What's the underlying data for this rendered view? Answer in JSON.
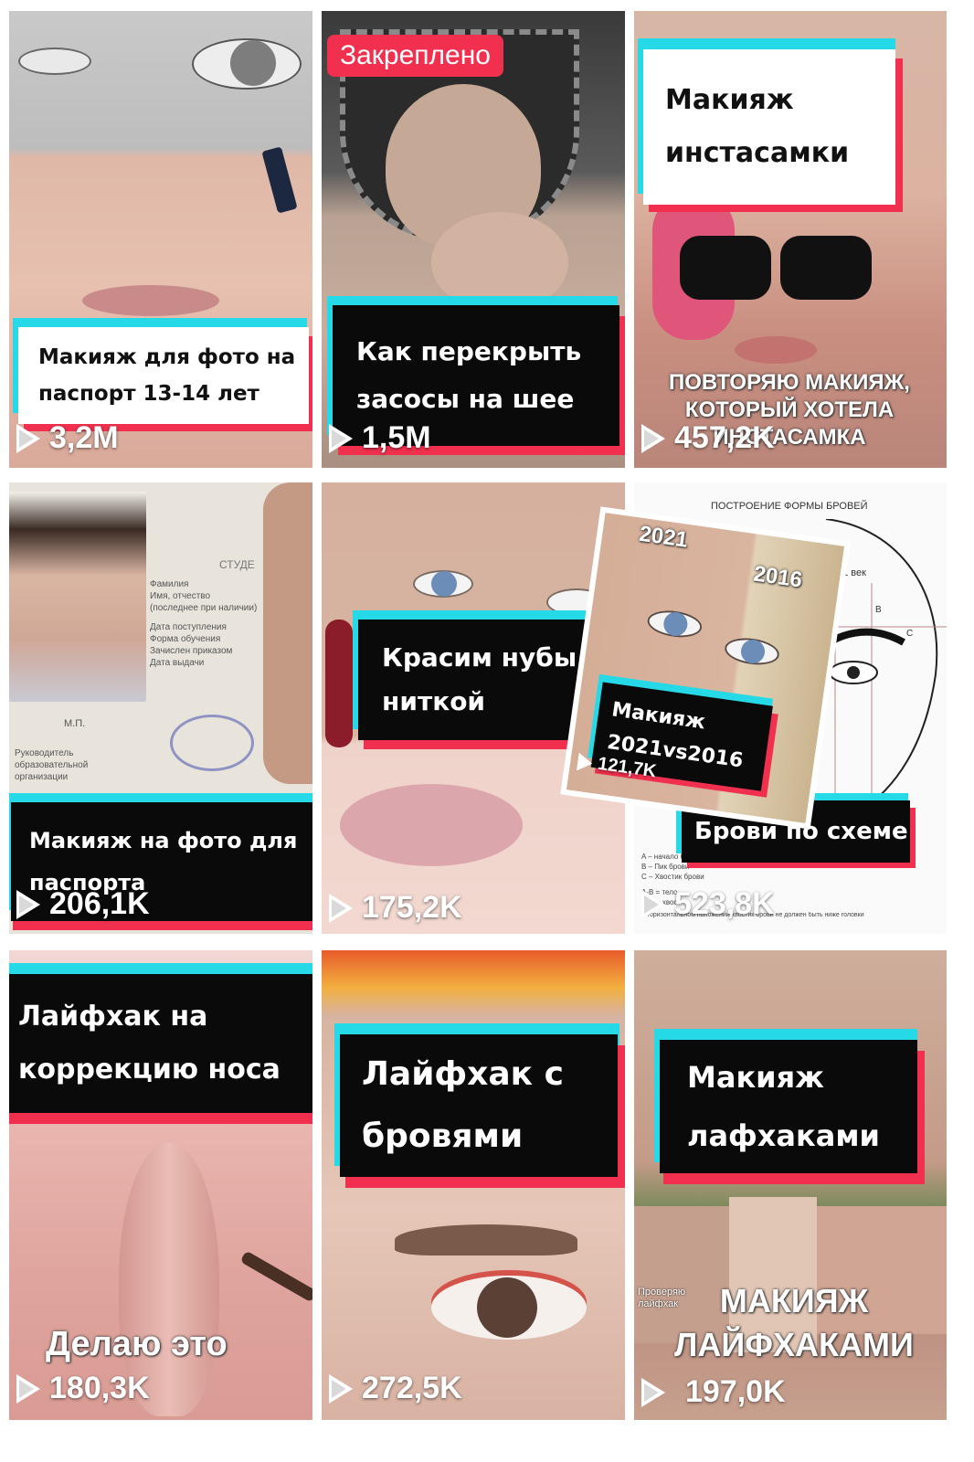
{
  "pinned_label": "Закреплено",
  "colors": {
    "cyan": "#25d9e6",
    "red": "#f0304e",
    "black": "#0a0a0a"
  },
  "icons": {
    "views": "play-icon"
  },
  "tiles": [
    {
      "lines": [
        "Макияж для фото на",
        "паспорт 13-14 лет"
      ],
      "views": "3,2M"
    },
    {
      "lines": [
        "Как перекрыть",
        "засосы на шее"
      ],
      "views": "1,5M"
    },
    {
      "lines": [
        "Макияж",
        "инстасамки"
      ],
      "views": "457,2K",
      "overlay": [
        "ПОВТОРЯЮ МАКИЯЖ,",
        "КОТОРЫЙ ХОТЕЛА",
        "ИНСТАСАМКА"
      ]
    },
    {
      "lines": [
        "Макияж на фото для",
        "паспорта"
      ],
      "views": "206,1K",
      "doc": {
        "title": "СТУДЕ",
        "rows": [
          "Фамилия",
          "Имя, отчество",
          "(последнее при наличии)",
          "Дата поступления",
          "Форма обучения",
          "Зачислен приказом",
          "Дата выдачи"
        ],
        "stamp": "М.П.",
        "footer": [
          "Руководитель",
          "образовательной",
          "организации"
        ]
      }
    },
    {
      "lines": [
        "Красим нубы",
        "ниткой"
      ],
      "views": "175,2K"
    },
    {
      "lines": [
        "Брови по схеме"
      ],
      "views": "523,8K",
      "header": "ПОСТРОЕНИЕ ФОРМЫ БРОВЕЙ",
      "diagram_labels": [
        "21 век",
        "A",
        "B",
        "C"
      ],
      "legend": [
        "A – начало брови",
        "B – Пик брови",
        "C – Хвостик брови",
        "A-B = тело",
        "B-C = хвост"
      ],
      "footer": "В горизонтальном положении хвостик брови не должен быть ниже головки",
      "inset": {
        "years": [
          "2021",
          "2016"
        ],
        "lines": [
          "Макияж",
          "2021vs2016"
        ],
        "views": "121,7K"
      }
    },
    {
      "lines": [
        "Лайфхак на",
        "коррекцию носа"
      ],
      "views": "180,3K",
      "overlay": [
        "Делаю это"
      ]
    },
    {
      "lines": [
        "Лайфхак с",
        "бровями"
      ],
      "views": "272,5K"
    },
    {
      "lines": [
        "Макияж",
        "лафхаками"
      ],
      "views": "197,0K",
      "overlay": [
        "МАКИЯЖ",
        "ЛАЙФХАКАМИ"
      ],
      "small": [
        "Проверяю",
        "лайфхак"
      ]
    }
  ]
}
